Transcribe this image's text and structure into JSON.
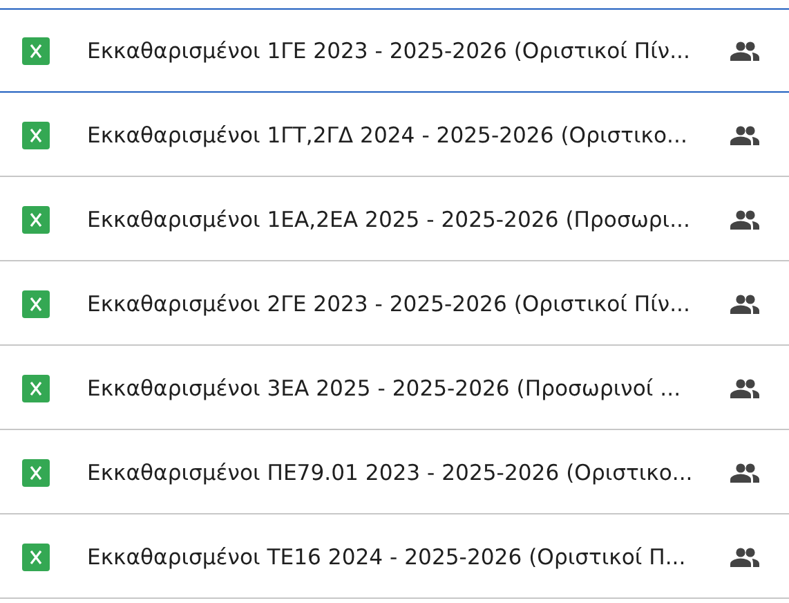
{
  "files": [
    {
      "name": "Εκκαθαρισμένοι 1ΓΕ 2023 - 2025-2026 (Οριστικοί Πίν...",
      "selected": true,
      "shared": true
    },
    {
      "name": "Εκκαθαρισμένοι 1ΓΤ,2ΓΔ 2024 - 2025-2026 (Οριστικο...",
      "selected": false,
      "shared": true
    },
    {
      "name": "Εκκαθαρισμένοι 1ΕΑ,2ΕΑ 2025 - 2025-2026 (Προσωρι...",
      "selected": false,
      "shared": true
    },
    {
      "name": "Εκκαθαρισμένοι 2ΓΕ 2023 - 2025-2026 (Οριστικοί Πίν...",
      "selected": false,
      "shared": true
    },
    {
      "name": "Εκκαθαρισμένοι 3ΕΑ 2025 - 2025-2026 (Προσωρινοί ...",
      "selected": false,
      "shared": true
    },
    {
      "name": "Εκκαθαρισμένοι ΠΕ79.01 2023 - 2025-2026 (Οριστικο...",
      "selected": false,
      "shared": true
    },
    {
      "name": "Εκκαθαρισμένοι ΤΕ16 2024 - 2025-2026 (Οριστικοί Π...",
      "selected": false,
      "shared": true
    }
  ]
}
